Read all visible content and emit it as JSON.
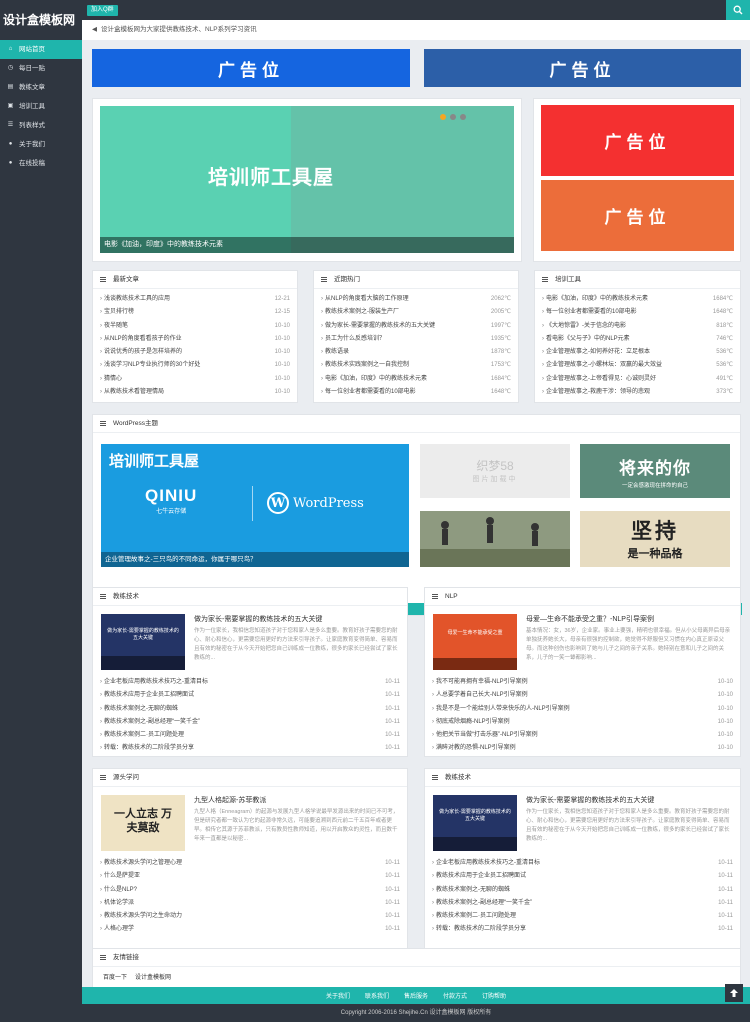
{
  "site": {
    "logo": "设计盒模板网",
    "qq_label": "加入Q群"
  },
  "notice": "设计盒模板网为大家提供教练技术、NLP系列学习资讯",
  "nav": [
    {
      "label": "网站首页",
      "icon": "home-icon",
      "active": true
    },
    {
      "label": "每日一贴",
      "icon": "clock-icon"
    },
    {
      "label": "教练文章",
      "icon": "book-icon"
    },
    {
      "label": "培训工具",
      "icon": "picture-icon"
    },
    {
      "label": "列表样式",
      "icon": "list-icon"
    },
    {
      "label": "关于我们",
      "icon": "chat-icon"
    },
    {
      "label": "在线投稿",
      "icon": "comments-icon"
    }
  ],
  "ads": {
    "label": "广告位"
  },
  "slider": {
    "image_text": "培训师工具屋",
    "caption": "电影《加油，印度》中的教练技术元素"
  },
  "latest": {
    "title": "最新文章",
    "items": [
      {
        "t": "浅谈教练技术工具的应用",
        "d": "12-21"
      },
      {
        "t": "宝贝排行榜",
        "d": "12-15"
      },
      {
        "t": "夜半随笔",
        "d": "10-10"
      },
      {
        "t": "从NLP的角度看看孩子的作业",
        "d": "10-10"
      },
      {
        "t": "说说优秀的孩子是怎样培养的",
        "d": "10-10"
      },
      {
        "t": "浅谈学习NLP专业执行师的30个好处",
        "d": "10-10"
      },
      {
        "t": "猜情心",
        "d": "10-10"
      },
      {
        "t": "从教练技术看管理情局",
        "d": "10-10"
      }
    ]
  },
  "hot": {
    "title": "近期热门",
    "items": [
      {
        "t": "从NLP的角度看大脑的工作原理",
        "d": "2062℃"
      },
      {
        "t": "教练技术案例之-服装生产厂",
        "d": "2005℃"
      },
      {
        "t": "做为家长-需要掌握的教练技术的五大关键",
        "d": "1997℃"
      },
      {
        "t": "员工为什么反感培训？",
        "d": "1935℃"
      },
      {
        "t": "教练语录",
        "d": "1878℃"
      },
      {
        "t": "教练技术实践案例之一自我控制",
        "d": "1753℃"
      },
      {
        "t": "电影《加油，印度》中的教练技术元素",
        "d": "1684℃"
      },
      {
        "t": "每一位创业者都需要看的10部电影",
        "d": "1648℃"
      }
    ]
  },
  "tools": {
    "title": "培训工具",
    "items": [
      {
        "t": "电影《加油，印度》中的教练技术元素",
        "d": "1684℃"
      },
      {
        "t": "每一位创业者都需要看的10部电影",
        "d": "1648℃"
      },
      {
        "t": "《大地惊雷》-关于信念的电影",
        "d": "818℃"
      },
      {
        "t": "看电影《父与子》中的NLP元素",
        "d": "746℃"
      },
      {
        "t": "企业管理故事之-如何养好花：立足根本",
        "d": "536℃"
      },
      {
        "t": "企业管理故事之-小螺林坛：双赢的最大效益",
        "d": "536℃"
      },
      {
        "t": "企业管理故事之-上帝看得见：心诚则灵好",
        "d": "491℃"
      },
      {
        "t": "企业管理故事之-救鹿干涉：领导的悲观",
        "d": "373℃"
      }
    ]
  },
  "wp": {
    "title": "WordPress主题",
    "big_title": "培训师工具屋",
    "qiniu": "QINIU",
    "qiniu_sub": "七牛云存储",
    "wordpress": "WordPress",
    "caption": "企业管理故事之-三只鸟的不同命运，你属于哪只鸟？",
    "g1": "织梦58",
    "g1b": "图片加载中",
    "g2": "将来的你",
    "g2b": "一定会感激现在拼命的自己",
    "g4": "坚持",
    "g4b": "是一种品格"
  },
  "sec_coach": {
    "title": "教练技术",
    "thumb": "做为家长-需要掌握的教练技术的五大关键",
    "ftitle": "做为家长-需要掌握的教练技术的五大关键",
    "fdesc": "作为一位家长，我相信您知道孩子对于您和家人是多么重要。教育好孩子需要您的耐心、耐心和信心，更需要您用更好的方法来引导孩子。让家庭教育变得简单、容易而且有效的秘密在于从今天开始把您自己训练成一位教练，很多的家长已经尝试了家长教练的...",
    "items": [
      {
        "t": "企业老板应用教练技术技巧之-重清目标",
        "d": "10-11"
      },
      {
        "t": "教练技术应用于企业员工招聘面试",
        "d": "10-11"
      },
      {
        "t": "教练技术案例之-无聊的蜘蛛",
        "d": "10-11"
      },
      {
        "t": "教练技术案例之-副总经理“一笑千金”",
        "d": "10-11"
      },
      {
        "t": "教练技术案例二·员工问题处理",
        "d": "10-11"
      },
      {
        "t": "转载：教练技术的二阶段学员分享",
        "d": "10-11"
      }
    ]
  },
  "sec_nlp": {
    "title": "NLP",
    "thumb": "母爱一生命不能承受之重",
    "ftitle": "母爱—生命不能承受之重？-NLP引导案例",
    "fdesc": "基本情况：女，36岁，企业家。事业上要强，精明也很幸福。但从小父母离异后母亲单独抚养她长大，母亲有很强的控制欲，她觉得不舒服但又习惯在内心真正原谅父母。而这种创伤也影响到了她与儿子之间的亲子关系。她特别在意和儿子之间的关系，儿子的一笑一颦都影响...",
    "items": [
      {
        "t": "我不可能再拥有幸福-NLP引导案例",
        "d": "10-10"
      },
      {
        "t": "人总要学着自己长大-NLP引导案例",
        "d": "10-10"
      },
      {
        "t": "我是不是一个能给别人带来快乐的人-NLP引导案例",
        "d": "10-10"
      },
      {
        "t": "彻底戒除烟瘾-NLP引导案例",
        "d": "10-10"
      },
      {
        "t": "他把关节当做“打击乐器”-NLP引导案例",
        "d": "10-10"
      },
      {
        "t": "满眸对教的恐惧-NLP引导案例",
        "d": "10-10"
      }
    ]
  },
  "sec_source": {
    "title": "源头学问",
    "thumb": "一人立志 万夫莫敌",
    "ftitle": "九型人格起源-苏菲教派",
    "fdesc": "九型人格（Enneagram）的起源与发展九型人格学说最早发源出来的时间已不可考，但是研究者都一致认为它的起源非常久远，可能要追溯到西元前二千五百年或者更早。相传它其源于苏菲教派，只有教员性教师知道，用以开启教众的灵性，而且数千年来一直都是以秘密...",
    "items": [
      {
        "t": "教练技术源头学问之管理心理",
        "d": "10-11"
      },
      {
        "t": "什么是萨提亚",
        "d": "10-11"
      },
      {
        "t": "什么是NLP?",
        "d": "10-11"
      },
      {
        "t": "机体论学派",
        "d": "10-11"
      },
      {
        "t": "教练技术源头学问之生命动力",
        "d": "10-11"
      },
      {
        "t": "人格心理学",
        "d": "10-11"
      }
    ]
  },
  "sec_coach2": {
    "title": "教练技术",
    "thumb": "做为家长-需要掌握的教练技术的五大关键",
    "ftitle": "做为家长-需要掌握的教练技术的五大关键",
    "fdesc": "作为一位家长，我相信您知道孩子对于您和家人是多么重要。教育好孩子需要您的耐心、耐心和信心，更需要您用更好的方法来引导孩子。让家庭教育变得简单、容易而且有效的秘密在于从今天开始把您自己训练成一位教练，很多的家长已经尝试了家长教练的...",
    "items": [
      {
        "t": "企业老板应用教练技术技巧之-重清目标",
        "d": "10-11"
      },
      {
        "t": "教练技术应用于企业员工招聘面试",
        "d": "10-11"
      },
      {
        "t": "教练技术案例之-无聊的蜘蛛",
        "d": "10-11"
      },
      {
        "t": "教练技术案例之-副总经理“一笑千金”",
        "d": "10-11"
      },
      {
        "t": "教练技术案例二·员工问题处理",
        "d": "10-11"
      },
      {
        "t": "转载：教练技术的二阶段学员分享",
        "d": "10-11"
      }
    ]
  },
  "friends": {
    "title": "友情链接",
    "links": [
      "百度一下",
      "设计盒模板网"
    ]
  },
  "footer": {
    "links": [
      "关于我们",
      "联系我们",
      "售后服务",
      "付款方式",
      "订购帮助"
    ],
    "copyright": "Copyright 2006-2016 Shejihe.Cn 设计盒模板网 版权所有"
  },
  "colors": {
    "teal": "#1fb5ac",
    "dark": "#2f3640",
    "ad_blue1": "#1565e0",
    "ad_blue2": "#2c5fa8",
    "ad_red": "#f43030",
    "ad_orange": "#ec6d3a",
    "slider_teal": "#5ad1b2"
  }
}
